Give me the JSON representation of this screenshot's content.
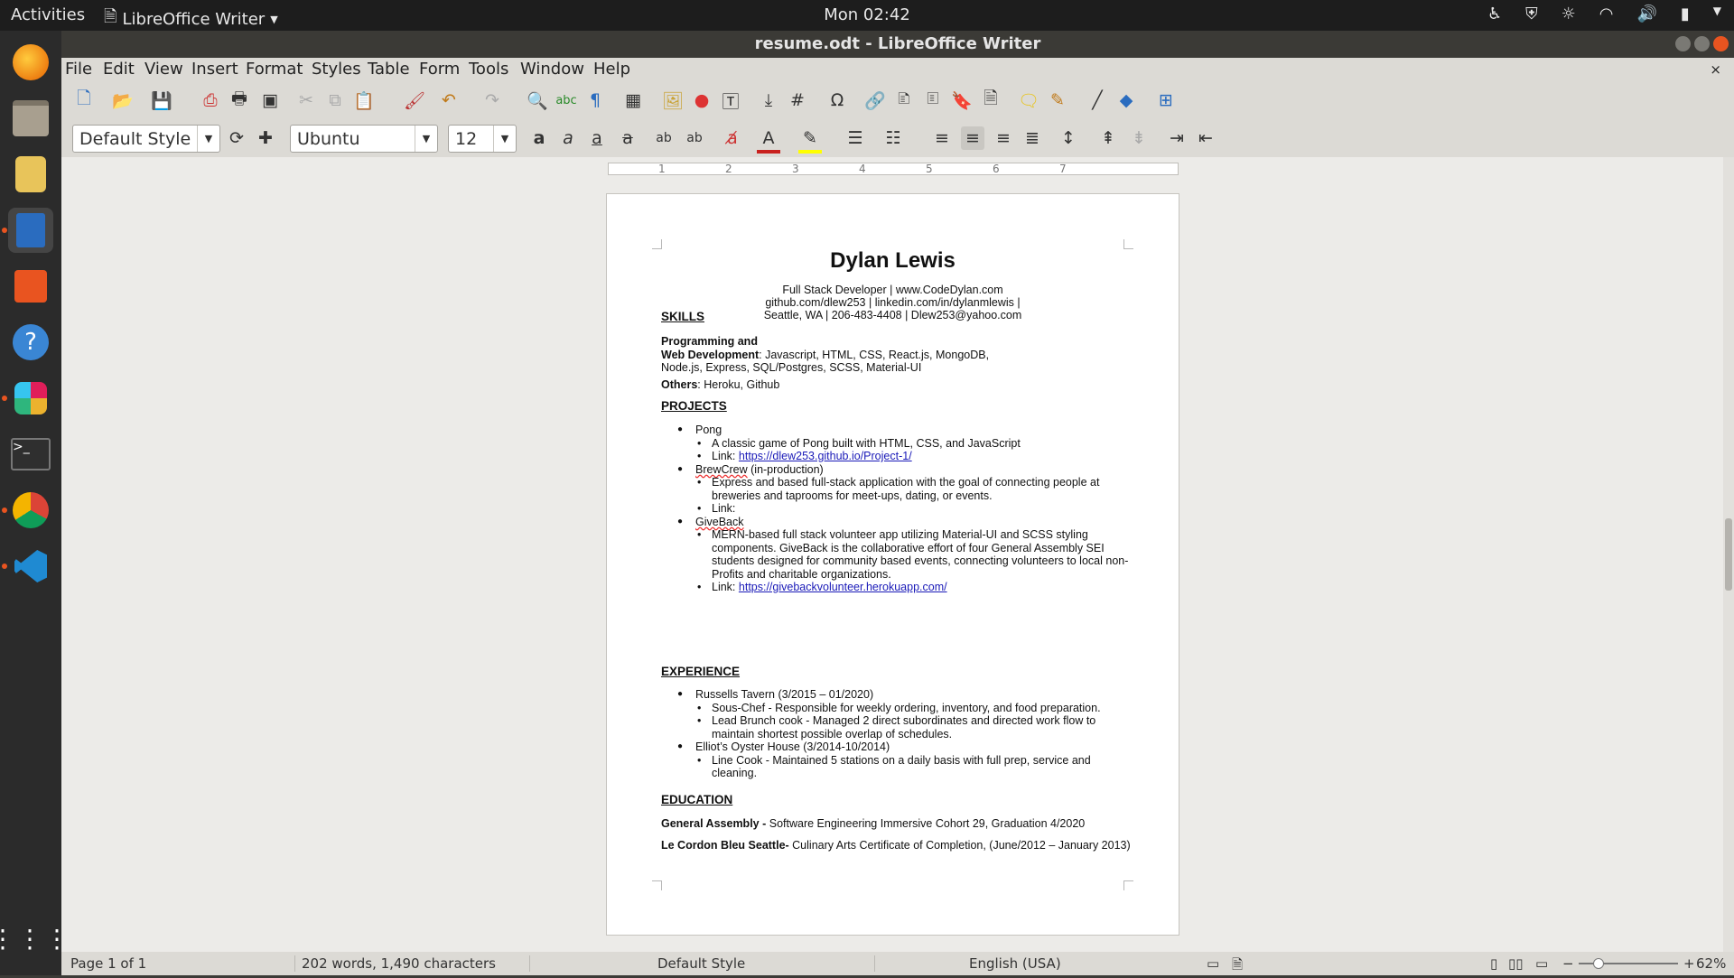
{
  "topbar": {
    "activities": "Activities",
    "app_name": "LibreOffice Writer",
    "clock": "Mon 02:42"
  },
  "window": {
    "title": "resume.odt - LibreOffice Writer"
  },
  "menu": [
    "File",
    "Edit",
    "View",
    "Insert",
    "Format",
    "Styles",
    "Table",
    "Form",
    "Tools",
    "Window",
    "Help"
  ],
  "format_bar": {
    "paragraph_style": "Default Style",
    "font_name": "Ubuntu",
    "font_size": "12"
  },
  "ruler": {
    "marks": [
      "1",
      "2",
      "3",
      "4",
      "5",
      "6",
      "7"
    ]
  },
  "doc": {
    "name": "Dylan Lewis",
    "contact1": "Full Stack Developer | www.CodeDylan.com",
    "contact2": "github.com/dlew253 | linkedin.com/in/dylanmlewis |",
    "contact3": "Seattle, WA | 206-483-4408 | Dlew253@yahoo.com",
    "skills_heading": "SKILLS",
    "skills_label1": "Programming and",
    "skills_label2": "Web Development",
    "skills_line1": ":  Javascript,  HTML,  CSS,  React.js,  MongoDB,",
    "skills_line2": " Node.js,  Express,  SQL/Postgres,  SCSS,  Material-UI",
    "others_label": "Others",
    "others_value": ":  Heroku,  Github",
    "projects_heading": "PROJECTS",
    "p1_title": "Pong",
    "p1_d1": "A classic game of Pong built with HTML, CSS, and JavaScript",
    "p1_link_label": "Link: ",
    "p1_link": "https://dlew253.github.io/Project-1/",
    "p2_title": "BrewCrew",
    "p2_note": " (in-production)",
    "p2_d1": "Express and based full-stack application with the goal of connecting people at breweries and taprooms for meet-ups, dating, or events.",
    "p2_link_label": "Link:",
    "p3_title": "GiveBack",
    "p3_d1": "MERN-based full stack volunteer app utilizing Material-UI and SCSS styling components. GiveBack is the collaborative effort of four General Assembly SEI students designed for community based events, connecting volunteers to local non-Profits and charitable organizations.",
    "p3_link_label": "Link: ",
    "p3_link": "https://givebackvolunteer.herokuapp.com/",
    "experience_heading": "EXPERIENCE",
    "e1_title": "Russells Tavern (3/2015 – 01/2020)",
    "e1_d1": "Sous-Chef  -  Responsible for weekly ordering, inventory, and food preparation.",
    "e1_d2": "Lead Brunch cook  -  Managed 2 direct subordinates and directed work flow to maintain shortest possible overlap of schedules.",
    "e2_title": "Elliot’s Oyster House (3/2014-10/2014)",
    "e2_d1": "Line Cook  -  Maintained 5 stations on a daily basis with full prep, service and cleaning.",
    "education_heading": "EDUCATION",
    "ed1_label": "General Assembly - ",
    "ed1_value": " Software Engineering Immersive Cohort 29,  Graduation 4/2020",
    "ed2_label": "Le Cordon Bleu Seattle- ",
    "ed2_value": " Culinary Arts Certificate of Completion, (June/2012 – January 2013)"
  },
  "status": {
    "page": "Page 1 of 1",
    "words": "202 words, 1,490 characters",
    "style": "Default Style",
    "language": "English (USA)",
    "zoom": "62%"
  }
}
